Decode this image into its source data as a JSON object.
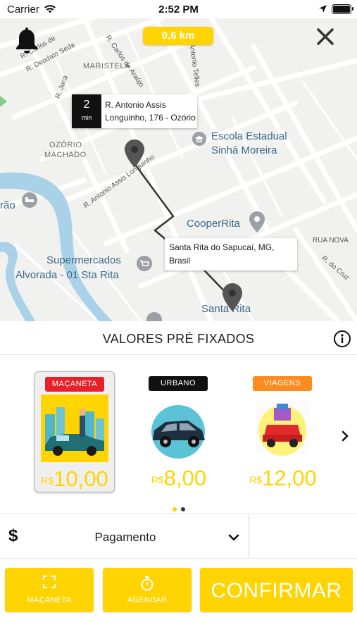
{
  "status_bar": {
    "carrier": "Carrier",
    "time": "2:52 PM"
  },
  "map": {
    "distance": "0,6 km",
    "origin": {
      "eta_value": "2",
      "eta_unit": "min",
      "line1": "R. Antonio Assis",
      "line2": "Longuinho, 176 - Ozório"
    },
    "destination": {
      "line1": "Santa Rita do Sapucaí, MG,",
      "line2": "Brasil"
    },
    "labels": {
      "neighborhood_maristela": "MARISTELA",
      "neighborhood_ozorio_1": "OZÓRIO",
      "neighborhood_ozorio_2": "MACHADO",
      "street_carlos": "R. Carlos de",
      "street_deodato": "R. Deodato Seda",
      "street_araujo": "R. Carlos de Araújo",
      "street_antonio_telles": "R. Antonio Telles",
      "street_juca": "R. Juca",
      "street_longuinho": "R. Antonio Assis Longuinho",
      "street_rua_nova": "RUA NOVA",
      "street_r_do_cruz": "R. do Cruz",
      "poi_escola_1": "Escola Estadual",
      "poi_escola_2": "Sinhá Moreira",
      "poi_cooperrita": "CooperRita",
      "poi_super_1": "Supermercados",
      "poi_super_2": "Alvorada - 01 Sta Rita",
      "poi_santa_rita": "Santa Rita",
      "poi_rao": "rão"
    }
  },
  "section": {
    "title": "VALORES PRÉ FIXADOS"
  },
  "cards": [
    {
      "badge": "MAÇANETA",
      "badge_color": "#e8202a",
      "currency": "R$",
      "price": "10,00",
      "selected": true
    },
    {
      "badge": "URBANO",
      "badge_color": "#111111",
      "currency": "R$",
      "price": "8,00",
      "selected": false
    },
    {
      "badge": "VIAGENS",
      "badge_color": "#ff8a1e",
      "currency": "R$",
      "price": "12,00",
      "selected": false
    }
  ],
  "pagination": {
    "active_color": "#ffd400",
    "inactive_color": "#333333"
  },
  "payment": {
    "icon": "$",
    "label": "Pagamento"
  },
  "buttons": {
    "macaneta": "MAÇANETA",
    "agendar": "AGENDAR",
    "confirmar": "CONFIRMAR"
  },
  "colors": {
    "accent": "#ffd400"
  }
}
